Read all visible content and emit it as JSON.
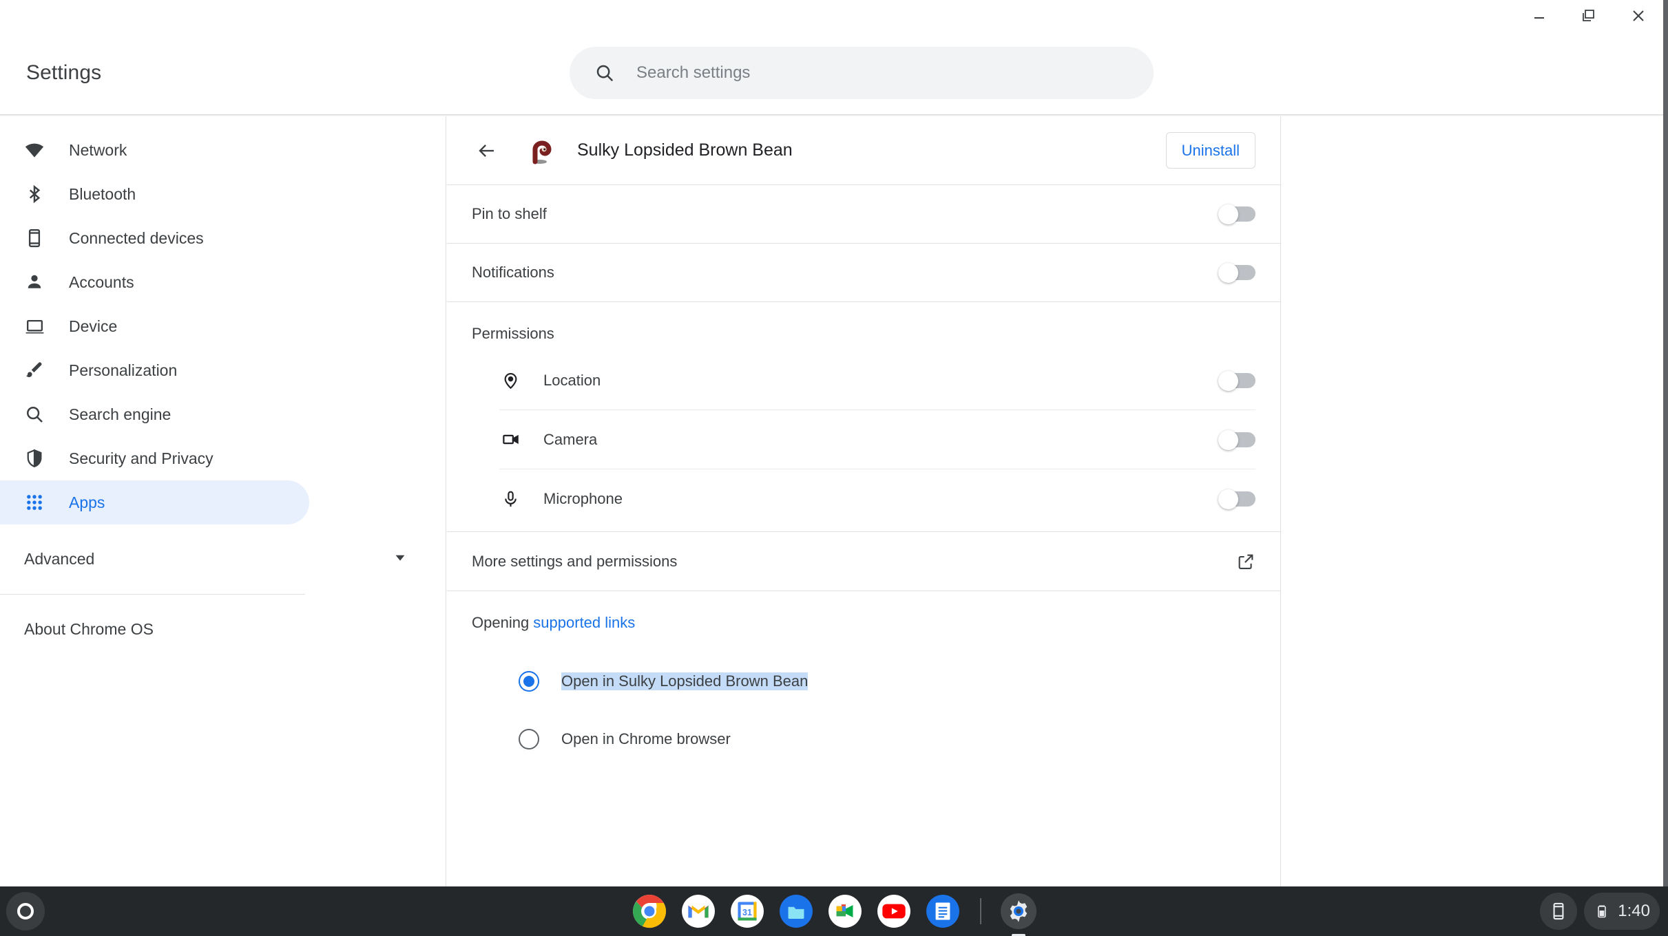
{
  "window_controls": {
    "minimize": "minimize-icon",
    "restore": "restore-icon",
    "close": "close-icon"
  },
  "header": {
    "title": "Settings",
    "search": {
      "placeholder": "Search settings",
      "value": "",
      "icon": "search-icon"
    }
  },
  "sidebar": {
    "items": [
      {
        "label": "Network",
        "icon": "wifi-icon",
        "selected": false
      },
      {
        "label": "Bluetooth",
        "icon": "bluetooth-icon",
        "selected": false
      },
      {
        "label": "Connected devices",
        "icon": "phone-icon",
        "selected": false
      },
      {
        "label": "Accounts",
        "icon": "person-icon",
        "selected": false
      },
      {
        "label": "Device",
        "icon": "laptop-icon",
        "selected": false
      },
      {
        "label": "Personalization",
        "icon": "brush-icon",
        "selected": false
      },
      {
        "label": "Search engine",
        "icon": "search-icon",
        "selected": false
      },
      {
        "label": "Security and Privacy",
        "icon": "shield-icon",
        "selected": false
      },
      {
        "label": "Apps",
        "icon": "apps-grid-icon",
        "selected": true
      }
    ],
    "advanced": {
      "label": "Advanced",
      "icon": "chevron-down-icon"
    },
    "about": {
      "label": "About Chrome OS"
    }
  },
  "app_detail": {
    "back_icon": "arrow-left-icon",
    "app_icon": "app-icon",
    "title": "Sulky Lopsided Brown Bean",
    "uninstall_label": "Uninstall",
    "rows": [
      {
        "label": "Pin to shelf",
        "toggle": "off"
      },
      {
        "label": "Notifications",
        "toggle": "off"
      }
    ],
    "permissions": {
      "title": "Permissions",
      "items": [
        {
          "label": "Location",
          "icon": "location-pin-icon",
          "toggle": "off"
        },
        {
          "label": "Camera",
          "icon": "camera-icon",
          "toggle": "off"
        },
        {
          "label": "Microphone",
          "icon": "microphone-icon",
          "toggle": "off"
        }
      ]
    },
    "more_settings": {
      "label": "More settings and permissions",
      "icon": "external-link-icon"
    },
    "supported_links": {
      "prefix": "Opening ",
      "link_text": "supported links",
      "options": [
        {
          "label": "Open in Sulky Lopsided Brown Bean",
          "checked": true,
          "text_selected": true
        },
        {
          "label": "Open in Chrome browser",
          "checked": false,
          "text_selected": false
        }
      ]
    }
  },
  "shelf": {
    "launcher": "launcher-icon",
    "apps": [
      {
        "name": "chrome-icon"
      },
      {
        "name": "gmail-icon"
      },
      {
        "name": "calendar-icon",
        "label": "31"
      },
      {
        "name": "files-icon"
      },
      {
        "name": "meet-icon"
      },
      {
        "name": "youtube-icon"
      },
      {
        "name": "docs-icon"
      }
    ],
    "settings_app": {
      "name": "settings-gear-icon",
      "active": true
    },
    "tray": {
      "phone_hub_icon": "phone-hub-icon",
      "battery_icon": "battery-icon",
      "time": "1:40"
    }
  },
  "colors": {
    "accent": "#1a73e8",
    "selected_bg": "#e8f0fe",
    "text_selection": "#c5dcf8",
    "shelf_bg": "#25282b",
    "app_icon": "#7b2a2a"
  }
}
